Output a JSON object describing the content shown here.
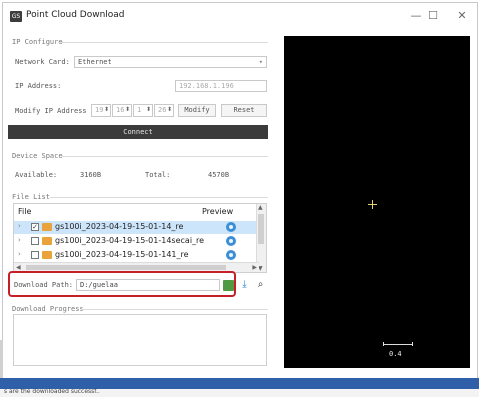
{
  "window": {
    "title": "Point Cloud Download",
    "app_icon": "app-icon",
    "controls": {
      "minimize": "—",
      "maximize": "☐",
      "close": "✕"
    }
  },
  "ip_configure": {
    "section_label": "IP Configure",
    "network_card_label": "Network Card:",
    "network_card_value": "Ethernet",
    "ip_address_label": "IP Address:",
    "ip_address_value": "192.168.1.196",
    "modify_ip_label": "Modify IP Address",
    "octets": [
      "19",
      "16",
      "1",
      "26"
    ],
    "modify_button": "Modify",
    "reset_button": "Reset",
    "connect_button": "Connect"
  },
  "device_space": {
    "section_label": "Device Space",
    "available_label": "Available:",
    "available_value": "3160B",
    "total_label": "Total:",
    "total_value": "4570B"
  },
  "file_list": {
    "section_label": "File List",
    "col_file": "File",
    "col_preview": "Preview",
    "rows": [
      {
        "name": "gs100i_2023-04-19-15-01-14_re",
        "checked": true,
        "selected": true
      },
      {
        "name": "gs100i_2023-04-19-15-01-14secai_re",
        "checked": false,
        "selected": false
      },
      {
        "name": "gs100i_2023-04-19-15-01-141_re",
        "checked": false,
        "selected": false
      }
    ]
  },
  "download": {
    "path_label": "Download Path:",
    "path_value": "D:/guelaa",
    "highlight_color": "#c51f27"
  },
  "download_progress": {
    "section_label": "Download Progress"
  },
  "preview": {
    "scale_text": "0.4"
  },
  "status": {
    "text": "s are the downloaded successf.."
  },
  "colors": {
    "accent": "#3c8fd6",
    "folder": "#e8a33d",
    "connect_bg": "#3b3b3b",
    "preview_bg": "#000000",
    "taskbar": "#2f5fa8"
  }
}
